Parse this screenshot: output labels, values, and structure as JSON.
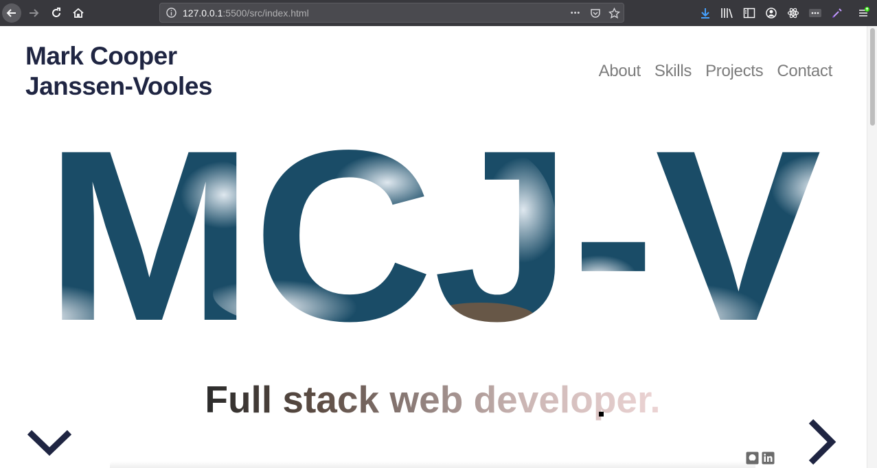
{
  "browser": {
    "url_host": "127.0.0.1",
    "url_rest": ":5500/src/index.html",
    "menu_dots": "•••"
  },
  "site": {
    "name_line1": "Mark Cooper",
    "name_line2": "Janssen-Vooles",
    "nav": [
      "About",
      "Skills",
      "Projects",
      "Contact"
    ],
    "hero_text": "MCJ-V",
    "subtitle": "Full stack web developer."
  },
  "colors": {
    "navy": "#1f2542",
    "nav_gray": "#7c7c7c",
    "ocean_dark": "#0e3a52",
    "ocean_mid": "#2e6786",
    "foam": "#e8edf2"
  },
  "icons": {
    "social": [
      "github-icon",
      "linkedin-icon"
    ]
  }
}
